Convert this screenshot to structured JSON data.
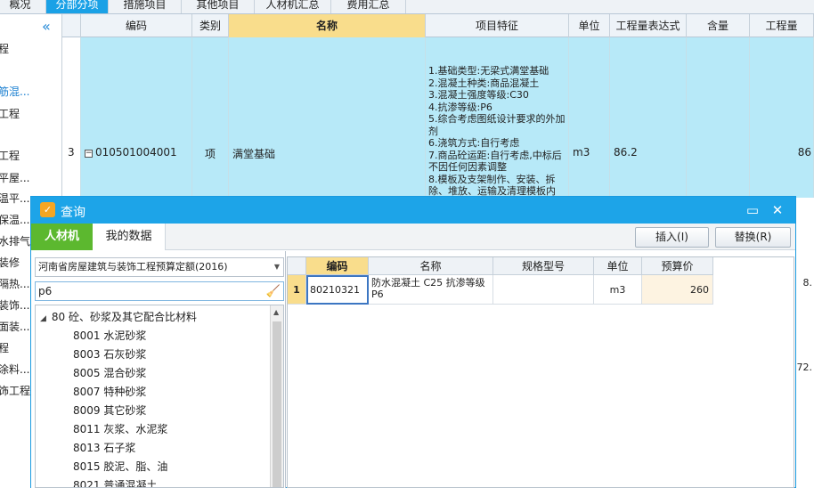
{
  "main": {
    "top_tabs": [
      {
        "label": "概况",
        "active": false
      },
      {
        "label": "分部分项",
        "active": true
      },
      {
        "label": "措施项目",
        "active": false
      },
      {
        "label": "其他项目",
        "active": false
      },
      {
        "label": "人材机汇总",
        "active": false
      },
      {
        "label": "费用汇总",
        "active": false
      }
    ],
    "left_tree": [
      {
        "label": "程",
        "link": false
      },
      {
        "label": "筋混...",
        "link": true
      },
      {
        "label": "工程",
        "link": false
      },
      {
        "label": "工程",
        "link": false
      },
      {
        "label": "平屋...",
        "link": false
      },
      {
        "label": "温平...",
        "link": false
      },
      {
        "label": "保温...",
        "link": false
      },
      {
        "label": "水排气",
        "link": false
      },
      {
        "label": "装修",
        "link": false
      },
      {
        "label": "隔热...",
        "link": false
      },
      {
        "label": "装饰...",
        "link": false
      },
      {
        "label": "面装...",
        "link": false
      },
      {
        "label": "程",
        "link": false
      },
      {
        "label": "涂料...",
        "link": false
      },
      {
        "label": "饰工程",
        "link": false
      }
    ],
    "grid": {
      "headers": [
        "",
        "编码",
        "类别",
        "名称",
        "项目特征",
        "单位",
        "工程量表达式",
        "含量",
        "工程量"
      ],
      "selected_header": "名称",
      "row": {
        "index": "3",
        "code": "010501004001",
        "category": "项",
        "name": "满堂基础",
        "features": "1.基础类型:无梁式满堂基础\n2.混凝土种类:商品混凝土\n3.混凝土强度等级:C30\n4.抗渗等级:P6\n5.综合考虑图纸设计要求的外加剂\n6.浇筑方式:自行考虑\n7.商品砼运距:自行考虑,中标后不因任何因素调整\n8.模板及支架制作、安装、拆除、堆放、运输及清理模板内",
        "unit": "m3",
        "expression": "86.2",
        "content": "",
        "quantity": "86"
      },
      "right_stub_1": "8.",
      "right_stub_2": "72."
    }
  },
  "dialog": {
    "title": "查询",
    "tabs": [
      {
        "label": "人材机",
        "active": true
      },
      {
        "label": "我的数据",
        "active": false
      }
    ],
    "insert_label": "插入(I)",
    "replace_label": "替换(R)",
    "library": "河南省房屋建筑与装饰工程预算定额(2016)",
    "search_value": "p6",
    "categories": [
      {
        "code": "80",
        "name": "砼、砂浆及其它配合比材料",
        "expanded": true,
        "level": 0
      },
      {
        "code": "8001",
        "name": "水泥砂浆",
        "level": 1
      },
      {
        "code": "8003",
        "name": "石灰砂浆",
        "level": 1
      },
      {
        "code": "8005",
        "name": "混合砂浆",
        "level": 1
      },
      {
        "code": "8007",
        "name": "特种砂浆",
        "level": 1
      },
      {
        "code": "8009",
        "name": "其它砂浆",
        "level": 1
      },
      {
        "code": "8011",
        "name": "灰浆、水泥浆",
        "level": 1
      },
      {
        "code": "8013",
        "name": "石子浆",
        "level": 1
      },
      {
        "code": "8015",
        "name": "胶泥、脂、油",
        "level": 1
      },
      {
        "code": "8021",
        "name": "普通混凝土",
        "level": 1
      }
    ],
    "results": {
      "headers": [
        "",
        "编码",
        "名称",
        "规格型号",
        "单位",
        "预算价"
      ],
      "selected_header": "编码",
      "rows": [
        {
          "index": "1",
          "code": "80210321",
          "name": "防水混凝土 C25 抗渗等级 P6",
          "spec": "",
          "unit": "m3",
          "price": "260"
        }
      ]
    }
  }
}
